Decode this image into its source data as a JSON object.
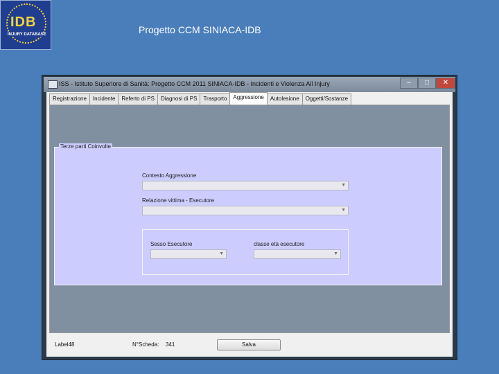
{
  "slide": {
    "title": "Progetto CCM SINIACA-IDB"
  },
  "logo": {
    "text": "IDB",
    "subtitle": "INJURY DATABASE"
  },
  "window": {
    "title": "ISS - Istituto Superiore di Sanità: Progetto CCM 2011 SINIACA-IDB - Incidenti e Violenza  All Injury",
    "controls": {
      "minimize": "–",
      "maximize": "□",
      "close": "✕"
    }
  },
  "tabs": [
    {
      "label": "Registrazione"
    },
    {
      "label": "Incidente"
    },
    {
      "label": "Referto di PS"
    },
    {
      "label": "Diagnosi di PS"
    },
    {
      "label": "Trasporto"
    },
    {
      "label": "Aggressione",
      "active": true
    },
    {
      "label": "Autolesione"
    },
    {
      "label": "Oggetti/Sostanze"
    }
  ],
  "form": {
    "group_title": "Terze parti Coinvolte",
    "contesto_label": "Contesto Aggressione",
    "contesto_value": "",
    "relazione_label": "Relazione vittima - Esecutore",
    "relazione_value": "",
    "sesso_label": "Sesso Esecutore",
    "sesso_value": "",
    "classe_label": "classe età esecutore",
    "classe_value": ""
  },
  "status": {
    "label": "Label48",
    "scheda_label": "N°Scheda:",
    "scheda_value": "341",
    "save_label": "Salva"
  },
  "icons": {
    "dropdown": "chevron-down-icon"
  }
}
